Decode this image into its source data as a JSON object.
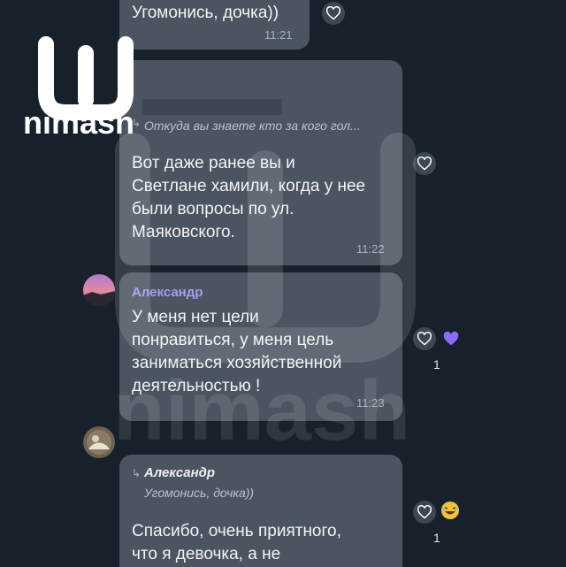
{
  "watermark": {
    "brand": "nimash",
    "big_brand": "nimash"
  },
  "messages": [
    {
      "text": "Угомонись, дочка))",
      "time": "11:21"
    },
    {
      "reply_quote": "Откуда вы знаете кто за кого гол...",
      "text": "Вот даже ранее вы и\nСветлане хамили, когда у нее\nбыли вопросы по ул.\nМаяковского.",
      "time": "11:22"
    },
    {
      "sender": "Александр",
      "text": "У меня нет цели\nпонравиться, у меня цель\nзаниматься хозяйственной\nдеятельностью !",
      "time": "11:23",
      "reaction_count": "1"
    },
    {
      "reply_author": "Александр",
      "reply_quote": "Угомонись, дочка))",
      "text": "Спасибо, очень приятного,\nчто я девочка, а не",
      "reaction_count": "1"
    }
  ],
  "colors": {
    "background": "#17212b",
    "bubble": "#4a5561",
    "sender_name": "#a99bf0",
    "heart_reaction": "#8a6cff"
  },
  "icons": [
    "heart-icon",
    "purple-heart-icon",
    "laughing-emoji-icon",
    "reply-arrow-icon"
  ]
}
